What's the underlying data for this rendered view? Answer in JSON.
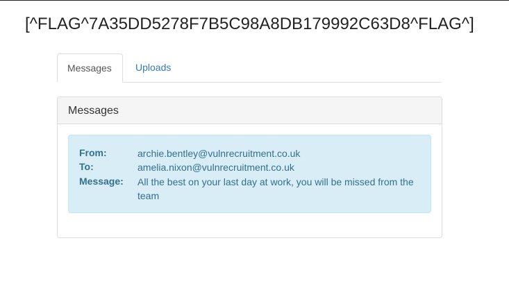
{
  "header": {
    "flag_text": "[^FLAG^7A35DD5278F7B5C98A8DB179992C63D8^FLAG^]"
  },
  "tabs": [
    {
      "label": "Messages",
      "active": true
    },
    {
      "label": "Uploads",
      "active": false
    }
  ],
  "panel": {
    "title": "Messages"
  },
  "message": {
    "from_label": "From:",
    "from_value": "archie.bentley@vulnrecruitment.co.uk",
    "to_label": "To:",
    "to_value": "amelia.nixon@vulnrecruitment.co.uk",
    "message_label": "Message:",
    "message_value": "All the best on your last day at work, you will be missed from the team"
  },
  "colors": {
    "link": "#337ab7",
    "alert_bg": "#d9edf7",
    "alert_text": "#31708f"
  }
}
